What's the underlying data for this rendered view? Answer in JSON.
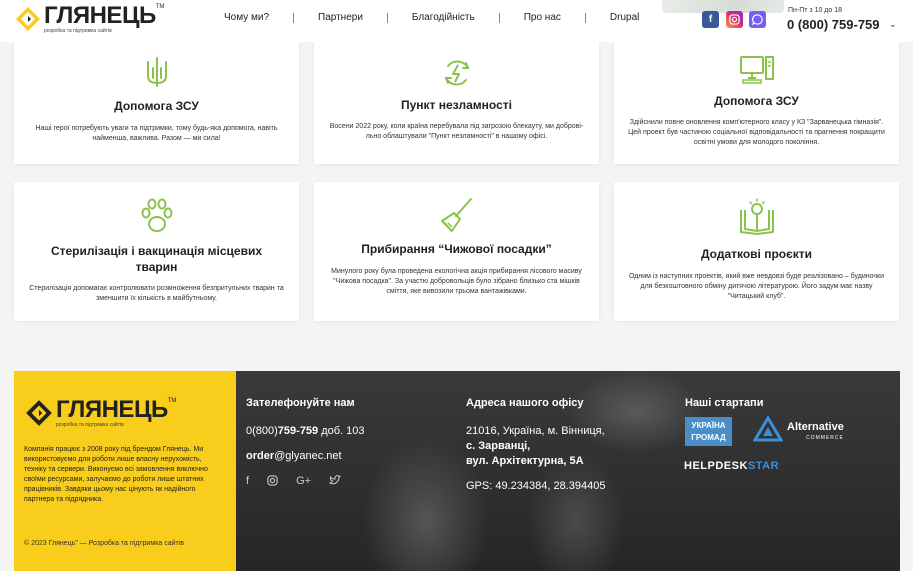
{
  "header": {
    "logo_name": "ГЛЯНЕЦЬ",
    "logo_tm": "TM",
    "logo_sub": "розробка та підтримка сайтів",
    "nav": [
      "Чому ми?",
      "Партнери",
      "Благодійність",
      "Про нас",
      "Drupal"
    ],
    "hours": "Пн-Пт з 10 до 18",
    "phone": "0 (800) 759-759",
    "social": [
      "facebook-icon",
      "instagram-icon",
      "viber-icon"
    ]
  },
  "cards": [
    {
      "icon": "trident-icon",
      "title": "Допомога ЗСУ",
      "text": "Наші герої потребують уваги та підтримки, тому будь-яка допомога, навіть найменша, важлива. Разом — ми сила!"
    },
    {
      "icon": "power-icon",
      "title": "Пункт незламності",
      "text": "Восени 2022 року, коли країна перебувала під загрозою блекауту, ми доброві­льно облаштували \"Пункт незламності\" в нашому офісі."
    },
    {
      "icon": "computer-icon",
      "title": "Допомога ЗСУ",
      "text": "Здійснили повне оновлення комп'ютерного класу у КЗ \"Зарванецька гімназія\". Цей проект був частиною соціальної відповідальності та прагнення покращити освітні умови для молодого покоління."
    },
    {
      "icon": "paw-icon",
      "title": "Стерилізація і вакцинація місцевих тварин",
      "text": "Стерилізація допомагає контролювати розмноження безпритульних тварин та зменшити їх кількість в майбутньому."
    },
    {
      "icon": "broom-icon",
      "title": "Прибирання “Чижової посадки”",
      "text": "Минулого року була проведена екологічна акція прибирання лісового масиву \"Чижова посадка\". За участю добровольців було зібрано близько ста мішків сміття, яке вивозили трьома вантажівками."
    },
    {
      "icon": "book-icon",
      "title": "Додаткові проєкти",
      "text": "Одним із наступних проектів, який вже невдовзі буде реалізовано – будиночки для безкоштовного обміну дитячою літературою. Його задум має назву \"Читацький клуб\"."
    }
  ],
  "footer": {
    "about": "Компанія працює з 2008 року під брендом Глянець. Ми використовуємо для роботи лише власну нерухомість, техніку та сервери. Виконуємо всі замовлення виключно своїми ресурсами, залучаємо до роботи лише штатних працівників. Завдяки цьому нас цінують як надійного партнера та підрядника.",
    "copyright": "© 2023 Глянець\" — Розробка та підтримка сайтів",
    "call_title": "Зателефонуйте нам",
    "phone_prefix": "0(800)",
    "phone_main": "759-759",
    "phone_ext": " доб. 103",
    "email_user": "order",
    "email_domain": "@glyanec.net",
    "office_title": "Адреса нашого офісу",
    "addr1": "21016, Україна, м. Вінниця,",
    "addr2": "с. Зарванці,",
    "addr3": "вул. Архітектурна, 5А",
    "gps": "GPS: 49.234384, 28.394405",
    "partners_title": "Наші стартапи",
    "ua_line1": "УКРАЇНА",
    "ua_line2": "ГРОМАД",
    "alt_name1": "Alternative",
    "alt_name2": "COMMERCE",
    "help_a": "HELPDESK",
    "help_b": "STAR",
    "icons": [
      "facebook-icon",
      "instagram-icon",
      "google-plus-icon",
      "twitter-icon"
    ]
  },
  "colors": {
    "accent_green": "#8bc34a",
    "footer_yellow": "#f8cd1c",
    "footer_dark": "#2f2f2f"
  }
}
